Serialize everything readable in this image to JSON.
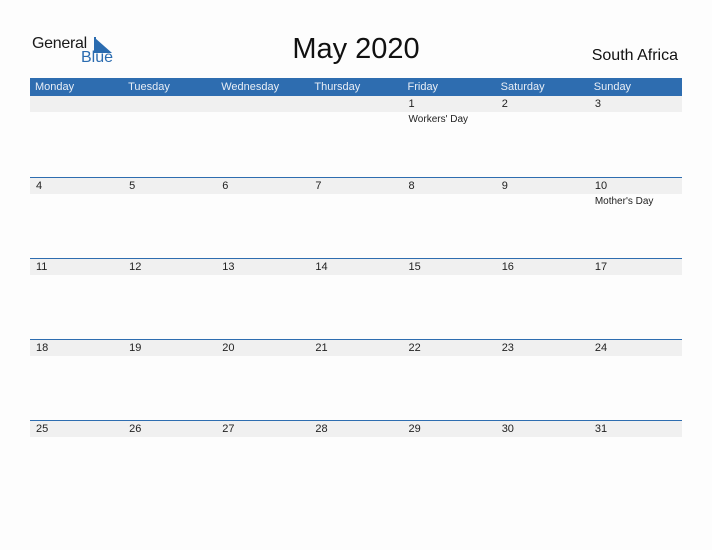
{
  "logo": {
    "line1": "General",
    "line2": "Blue",
    "icon": "triangle-flag-icon"
  },
  "title": "May 2020",
  "country": "South Africa",
  "colors": {
    "accent": "#2e6db0",
    "date_strip": "#f0f0f0"
  },
  "weekdays": [
    "Monday",
    "Tuesday",
    "Wednesday",
    "Thursday",
    "Friday",
    "Saturday",
    "Sunday"
  ],
  "weeks": [
    [
      {
        "day": ""
      },
      {
        "day": ""
      },
      {
        "day": ""
      },
      {
        "day": ""
      },
      {
        "day": "1",
        "holiday": "Workers' Day"
      },
      {
        "day": "2"
      },
      {
        "day": "3"
      }
    ],
    [
      {
        "day": "4"
      },
      {
        "day": "5"
      },
      {
        "day": "6"
      },
      {
        "day": "7"
      },
      {
        "day": "8"
      },
      {
        "day": "9"
      },
      {
        "day": "10",
        "holiday": "Mother's Day"
      }
    ],
    [
      {
        "day": "11"
      },
      {
        "day": "12"
      },
      {
        "day": "13"
      },
      {
        "day": "14"
      },
      {
        "day": "15"
      },
      {
        "day": "16"
      },
      {
        "day": "17"
      }
    ],
    [
      {
        "day": "18"
      },
      {
        "day": "19"
      },
      {
        "day": "20"
      },
      {
        "day": "21"
      },
      {
        "day": "22"
      },
      {
        "day": "23"
      },
      {
        "day": "24"
      }
    ],
    [
      {
        "day": "25"
      },
      {
        "day": "26"
      },
      {
        "day": "27"
      },
      {
        "day": "28"
      },
      {
        "day": "29"
      },
      {
        "day": "30"
      },
      {
        "day": "31"
      }
    ]
  ]
}
